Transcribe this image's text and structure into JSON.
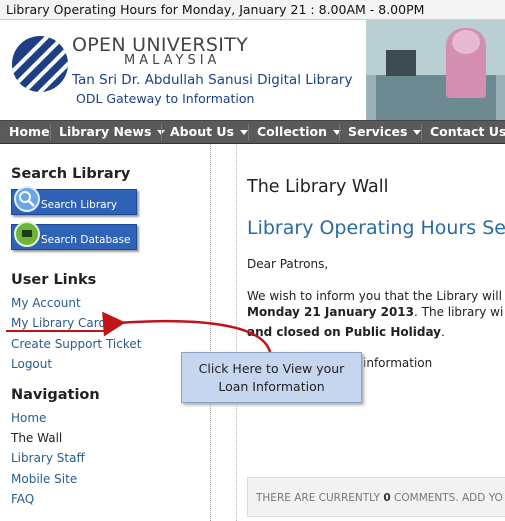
{
  "topbar": {
    "text": "Library Operating Hours for Monday, January 21 : 8.00AM - 8.00PM"
  },
  "header": {
    "brand_line1": "OPEN UNIVERSITY",
    "brand_line2": "MALAYSIA",
    "brand_line3": "Tan Sri Dr. Abdullah Sanusi Digital Library",
    "brand_line4": "ODL Gateway to Information"
  },
  "nav": {
    "items": [
      {
        "label": "Home"
      },
      {
        "label": "Library News"
      },
      {
        "label": "About Us"
      },
      {
        "label": "Collection"
      },
      {
        "label": "Services"
      },
      {
        "label": "Contact Us"
      }
    ]
  },
  "sidebar": {
    "search_heading": "Search Library",
    "search_library_button": "Search Library",
    "search_database_button": "Search Database",
    "user_links_heading": "User Links",
    "user_links": [
      "My Account",
      "My Library Card",
      "Create Support Ticket",
      "Logout"
    ],
    "navigation_heading": "Navigation",
    "navigation_links": [
      "Home",
      "The Wall",
      "Library Staff",
      "Mobile Site",
      "FAQ"
    ]
  },
  "callout": {
    "line1": "Click Here to View your",
    "line2": "Loan Information"
  },
  "main": {
    "wall_title": "The Library Wall",
    "post_title": "Library Operating Hours Se",
    "greeting": "Dear Patrons,",
    "line1": "We wish to inform you that the Library will b",
    "line2_bold": "Monday 21 January 2013",
    "line2_rest": ". The library wi",
    "line3_bold": "and closed on Public Holiday",
    "line3_rest": ".",
    "line4": "information",
    "comments_prefix": "THERE ARE CURRENTLY ",
    "comments_count": "0",
    "comments_suffix": " COMMENTS. ADD YO"
  },
  "colors": {
    "accent_blue": "#2a6aa3",
    "nav_bg": "#5a5a5a",
    "button_blue": "#2f63b8",
    "highlight_red": "#c0141b",
    "callout_bg": "#c5d6ee"
  },
  "icons": {
    "search_library": "magnifier-icon",
    "search_database": "database-icon",
    "nav_dropdown": "chevron-down-icon",
    "logo": "oum-logo"
  }
}
